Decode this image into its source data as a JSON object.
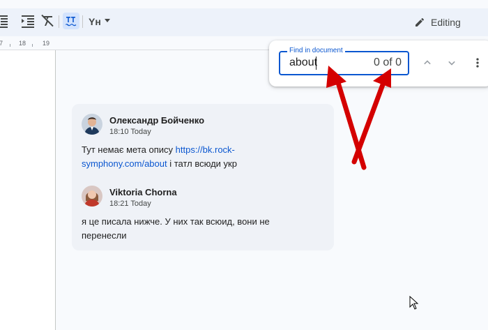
{
  "toolbar": {
    "icons": [
      "decrease-indent-icon",
      "increase-indent-icon",
      "clear-formatting-icon",
      "spellcheck-icon",
      "input-tools-icon",
      "dropdown-caret-icon"
    ],
    "input_tools_label": "Yн",
    "editing_label": "Editing",
    "editing_icon": "pencil-icon"
  },
  "ruler": {
    "labels": [
      "7",
      "18",
      "19"
    ]
  },
  "find": {
    "label": "Find in document",
    "value": "about",
    "count": "0 of 0",
    "prev_icon": "chevron-up-icon",
    "next_icon": "chevron-down-icon",
    "more_icon": "more-vert-icon"
  },
  "comments": [
    {
      "author": "Олександр Бойченко",
      "time": "18:10 Today",
      "text_before": "Тут немає мета опису ",
      "link": "https://bk.rock-symphony.com/about",
      "text_after": " і татл всюди укр"
    },
    {
      "author": "Viktoria Chorna",
      "time": "18:21 Today",
      "text": "я це писала нижче. У них так всюид, вони не перенесли"
    }
  ],
  "colors": {
    "accent": "#0b57d0",
    "toolbar_bg": "#edf2fa",
    "canvas_bg": "#f8fafd",
    "card_bg": "#eff2f7",
    "annotation_arrow": "#d40000"
  }
}
